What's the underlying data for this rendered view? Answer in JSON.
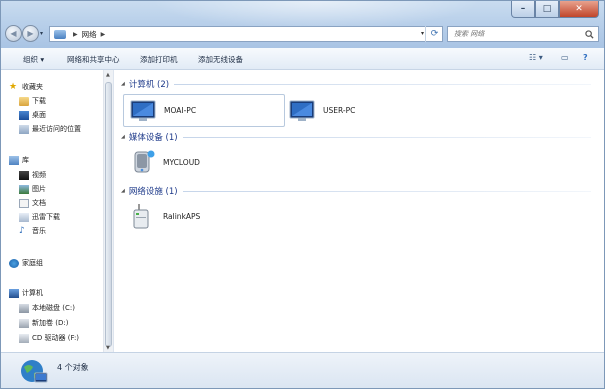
{
  "window": {
    "address": {
      "crumb": "网络"
    },
    "search": {
      "placeholder": "搜索 网络"
    }
  },
  "toolbar": {
    "organize": "组织 ▾",
    "network_sharing": "网络和共享中心",
    "add_printer": "添加打印机",
    "add_wireless": "添加无线设备"
  },
  "nav": {
    "favorites": "收藏夹",
    "downloads": "下载",
    "desktop": "桌面",
    "recent": "最近访问的位置",
    "libraries": "库",
    "videos": "视频",
    "pictures": "图片",
    "documents": "文档",
    "thunder": "迅雷下载",
    "music": "音乐",
    "homegroup": "家庭组",
    "computer": "计算机",
    "drive_c": "本地磁盘 (C:)",
    "drive_d": "新加卷 (D:)",
    "drive_f": "CD 驱动器 (F:)"
  },
  "groups": {
    "computers": {
      "label": "计算机 (2)",
      "items": [
        "MOAI-PC",
        "USER-PC"
      ]
    },
    "media": {
      "label": "媒体设备 (1)",
      "items": [
        "MYCLOUD"
      ]
    },
    "network": {
      "label": "网络设施 (1)",
      "items": [
        "RalinkAPS"
      ]
    }
  },
  "status": {
    "text": "4 个对象"
  },
  "colors": {
    "accent": "#1e3a8a",
    "frame": "#a9c4e4"
  }
}
